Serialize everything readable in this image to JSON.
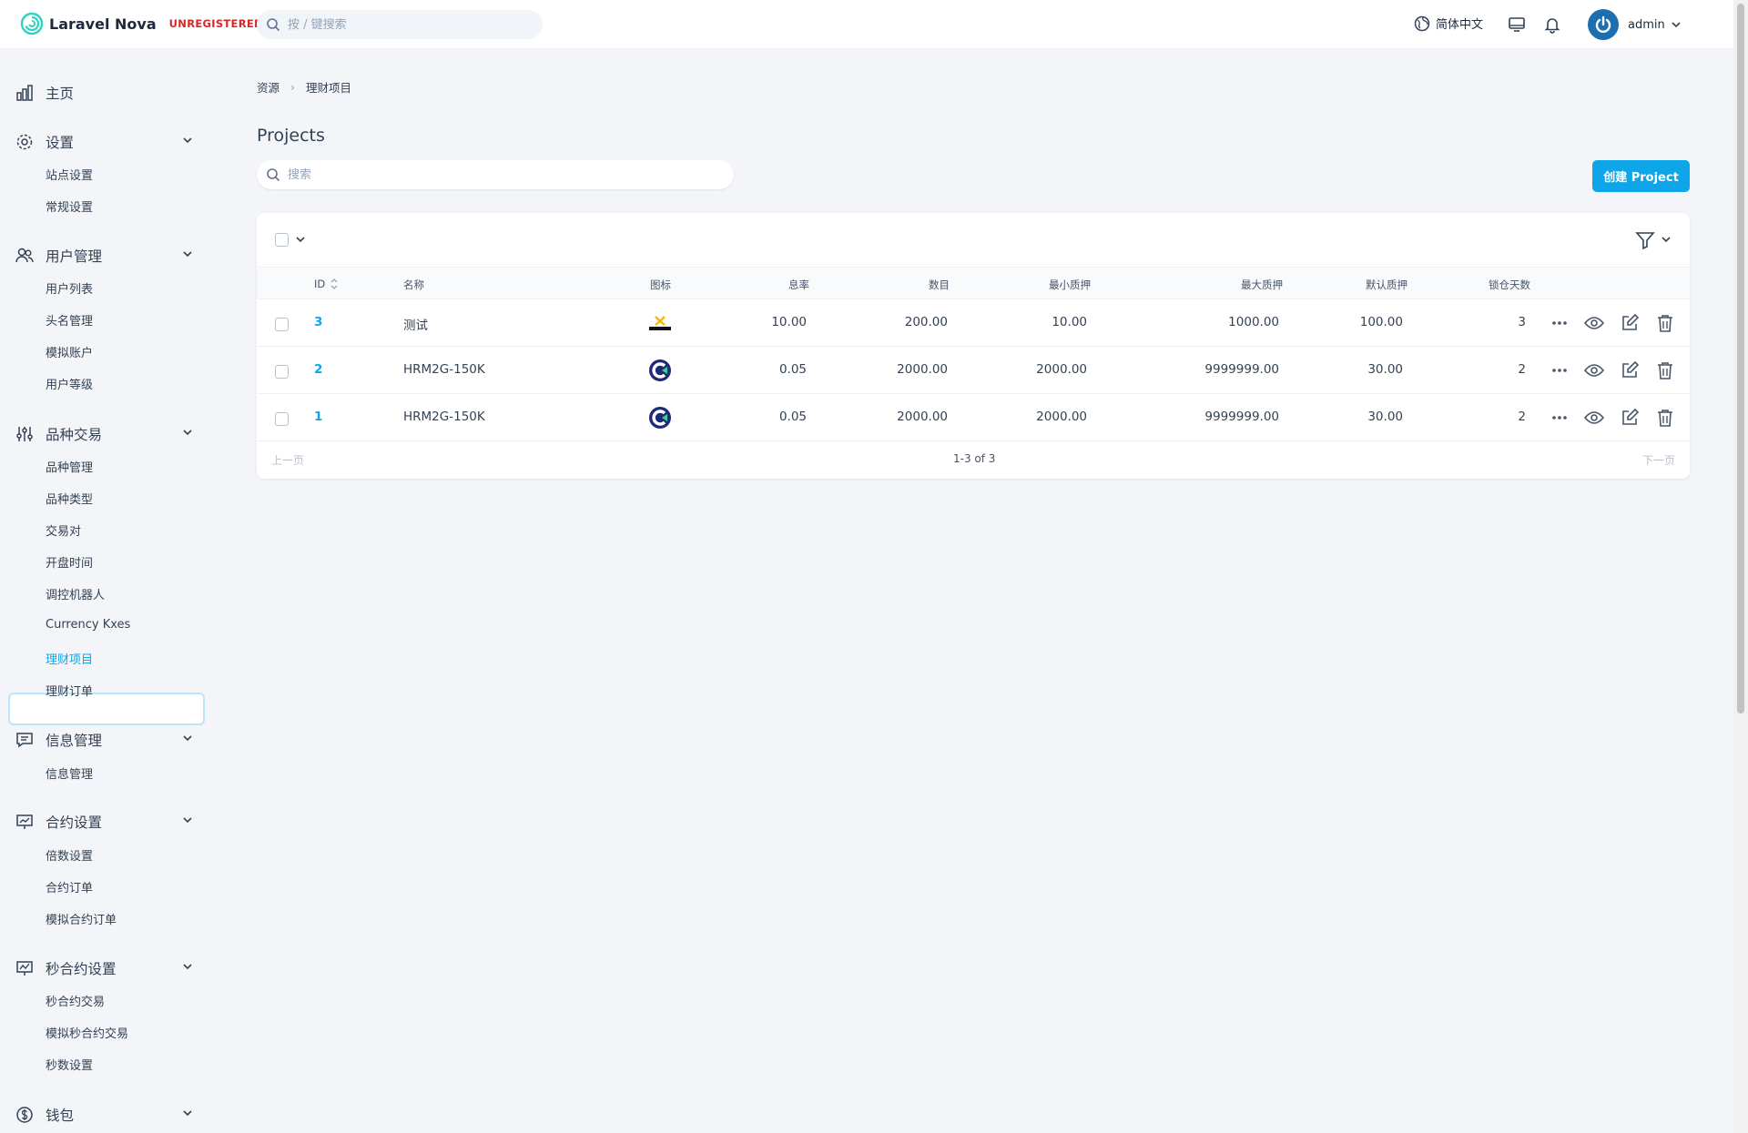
{
  "header": {
    "brand": "Laravel Nova",
    "badge": "UNREGISTERED",
    "search_placeholder": "按 / 键搜索",
    "language": "简体中文",
    "user": "admin"
  },
  "sidebar": {
    "home": "主页",
    "groups": [
      {
        "label": "设置",
        "icon": "gear-icon",
        "items": [
          "站点设置",
          "常规设置"
        ]
      },
      {
        "label": "用户管理",
        "icon": "users-icon",
        "items": [
          "用户列表",
          "头名管理",
          "模拟账户",
          "用户等级"
        ]
      },
      {
        "label": "品种交易",
        "icon": "sliders-icon",
        "items": [
          "品种管理",
          "品种类型",
          "交易对",
          "开盘时间",
          "调控机器人",
          "Currency Kxes",
          "理财项目",
          "理财订单"
        ]
      },
      {
        "label": "信息管理",
        "icon": "message-icon",
        "items": [
          "信息管理"
        ]
      },
      {
        "label": "合约设置",
        "icon": "presentation-icon",
        "items": [
          "倍数设置",
          "合约订单",
          "模拟合约订单"
        ]
      },
      {
        "label": "秒合约设置",
        "icon": "chart-icon",
        "items": [
          "秒合约交易",
          "模拟秒合约交易",
          "秒数设置"
        ]
      },
      {
        "label": "钱包",
        "icon": "dollar-icon",
        "items": []
      }
    ],
    "active_item": "理财项目"
  },
  "main": {
    "breadcrumb": [
      "资源",
      "理财项目"
    ],
    "title": "Projects",
    "search_placeholder": "搜索",
    "create_label": "创建 Project",
    "columns": [
      "ID",
      "名称",
      "图标",
      "息率",
      "数目",
      "最小质押",
      "最大质押",
      "默认质押",
      "锁仓天数"
    ],
    "rows": [
      {
        "id": "3",
        "name": "测试",
        "icon": "express-logo",
        "rate": "10.00",
        "amount": "200.00",
        "min": "10.00",
        "max": "1000.00",
        "default": "100.00",
        "days": "3"
      },
      {
        "id": "2",
        "name": "HRM2G-150K",
        "icon": "c-logo",
        "rate": "0.05",
        "amount": "2000.00",
        "min": "2000.00",
        "max": "9999999.00",
        "default": "30.00",
        "days": "2"
      },
      {
        "id": "1",
        "name": "HRM2G-150K",
        "icon": "c-logo",
        "rate": "0.05",
        "amount": "2000.00",
        "min": "2000.00",
        "max": "9999999.00",
        "default": "30.00",
        "days": "2"
      }
    ],
    "pager": {
      "prev": "上一页",
      "info": "1-3 of 3",
      "next": "下一页"
    }
  },
  "colors": {
    "accent": "#0ea5e9",
    "badge": "#dc2626",
    "avatar": "#1b6fb0"
  }
}
